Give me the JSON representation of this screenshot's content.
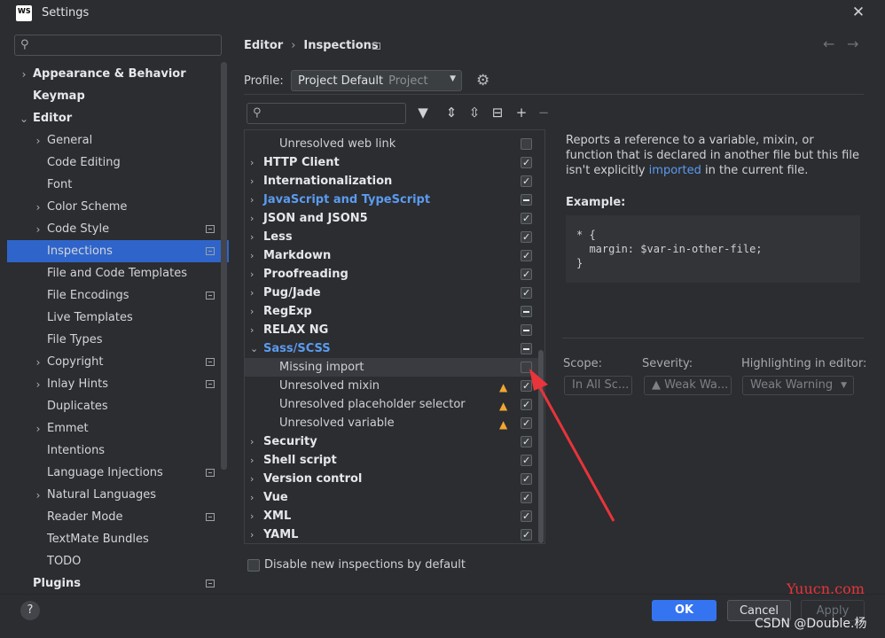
{
  "window": {
    "title": "Settings",
    "logo_text": "WS"
  },
  "sidebar": {
    "search_placeholder": "",
    "items": [
      {
        "label": "Appearance & Behavior",
        "level": 0,
        "bold": true,
        "chevron": ">",
        "icon": false
      },
      {
        "label": "Keymap",
        "level": 0,
        "bold": true,
        "chevron": "",
        "icon": false
      },
      {
        "label": "Editor",
        "level": 0,
        "bold": true,
        "chevron": "v",
        "icon": false
      },
      {
        "label": "General",
        "level": 1,
        "chevron": ">",
        "icon": false
      },
      {
        "label": "Code Editing",
        "level": 1,
        "chevron": "",
        "icon": false
      },
      {
        "label": "Font",
        "level": 1,
        "chevron": "",
        "icon": false
      },
      {
        "label": "Color Scheme",
        "level": 1,
        "chevron": ">",
        "icon": false
      },
      {
        "label": "Code Style",
        "level": 1,
        "chevron": ">",
        "icon": true
      },
      {
        "label": "Inspections",
        "level": 1,
        "chevron": "",
        "icon": true,
        "selected": true
      },
      {
        "label": "File and Code Templates",
        "level": 1,
        "chevron": "",
        "icon": false
      },
      {
        "label": "File Encodings",
        "level": 1,
        "chevron": "",
        "icon": true
      },
      {
        "label": "Live Templates",
        "level": 1,
        "chevron": "",
        "icon": false
      },
      {
        "label": "File Types",
        "level": 1,
        "chevron": "",
        "icon": false
      },
      {
        "label": "Copyright",
        "level": 1,
        "chevron": ">",
        "icon": true
      },
      {
        "label": "Inlay Hints",
        "level": 1,
        "chevron": ">",
        "icon": true
      },
      {
        "label": "Duplicates",
        "level": 1,
        "chevron": "",
        "icon": false
      },
      {
        "label": "Emmet",
        "level": 1,
        "chevron": ">",
        "icon": false
      },
      {
        "label": "Intentions",
        "level": 1,
        "chevron": "",
        "icon": false
      },
      {
        "label": "Language Injections",
        "level": 1,
        "chevron": "",
        "icon": true
      },
      {
        "label": "Natural Languages",
        "level": 1,
        "chevron": ">",
        "icon": false
      },
      {
        "label": "Reader Mode",
        "level": 1,
        "chevron": "",
        "icon": true
      },
      {
        "label": "TextMate Bundles",
        "level": 1,
        "chevron": "",
        "icon": false
      },
      {
        "label": "TODO",
        "level": 1,
        "chevron": "",
        "icon": false
      },
      {
        "label": "Plugins",
        "level": 0,
        "bold": true,
        "chevron": "",
        "icon": true
      }
    ]
  },
  "header": {
    "crumb_parent": "Editor",
    "crumb_current": "Inspections",
    "profile_label": "Profile:",
    "profile_value": "Project Default",
    "profile_scope": "Project"
  },
  "list": {
    "search_placeholder": "",
    "rows": [
      {
        "label": "Unresolved web link",
        "type": "leaf",
        "state": "off",
        "warn": false
      },
      {
        "label": "HTTP Client",
        "type": "group",
        "state": "on"
      },
      {
        "label": "Internationalization",
        "type": "group",
        "state": "on"
      },
      {
        "label": "JavaScript and TypeScript",
        "type": "group",
        "state": "mixed",
        "blue": true
      },
      {
        "label": "JSON and JSON5",
        "type": "group",
        "state": "on"
      },
      {
        "label": "Less",
        "type": "group",
        "state": "on"
      },
      {
        "label": "Markdown",
        "type": "group",
        "state": "on"
      },
      {
        "label": "Proofreading",
        "type": "group",
        "state": "on"
      },
      {
        "label": "Pug/Jade",
        "type": "group",
        "state": "on"
      },
      {
        "label": "RegExp",
        "type": "group",
        "state": "mixed"
      },
      {
        "label": "RELAX NG",
        "type": "group",
        "state": "mixed"
      },
      {
        "label": "Sass/SCSS",
        "type": "group",
        "state": "mixed",
        "blue": true,
        "expanded": true
      },
      {
        "label": "Missing import",
        "type": "leaf",
        "state": "off",
        "warn": false,
        "highlight": true
      },
      {
        "label": "Unresolved mixin",
        "type": "leaf",
        "state": "on",
        "warn": true
      },
      {
        "label": "Unresolved placeholder selector",
        "type": "leaf",
        "state": "on",
        "warn": true
      },
      {
        "label": "Unresolved variable",
        "type": "leaf",
        "state": "on",
        "warn": true
      },
      {
        "label": "Security",
        "type": "group",
        "state": "on"
      },
      {
        "label": "Shell script",
        "type": "group",
        "state": "on"
      },
      {
        "label": "Version control",
        "type": "group",
        "state": "on"
      },
      {
        "label": "Vue",
        "type": "group",
        "state": "on"
      },
      {
        "label": "XML",
        "type": "group",
        "state": "on"
      },
      {
        "label": "YAML",
        "type": "group",
        "state": "on"
      }
    ]
  },
  "description": {
    "text_before": "Reports a reference to a variable, mixin, or function that is declared in another file but this file isn't explicitly ",
    "link": "imported",
    "text_after": " in the current file.",
    "example_label": "Example:",
    "example_code": "* {\n  margin: $var-in-other-file;\n}"
  },
  "options": {
    "scope_label": "Scope:",
    "scope_value": "In All Sc...",
    "severity_label": "Severity:",
    "severity_value": "Weak Wa...",
    "highlight_label": "Highlighting in editor:",
    "highlight_value": "Weak Warning"
  },
  "bottom": {
    "disable_label": "Disable new inspections by default",
    "help": "?",
    "ok": "OK",
    "cancel": "Cancel",
    "apply": "Apply"
  },
  "watermarks": {
    "site": "Yuucn.com",
    "credit": "CSDN @Double.杨"
  },
  "colors": {
    "accent": "#3574f0",
    "selection": "#2f65ca",
    "link": "#5b9bf0",
    "warning": "#f0a732",
    "annotation": "#e8343b"
  }
}
